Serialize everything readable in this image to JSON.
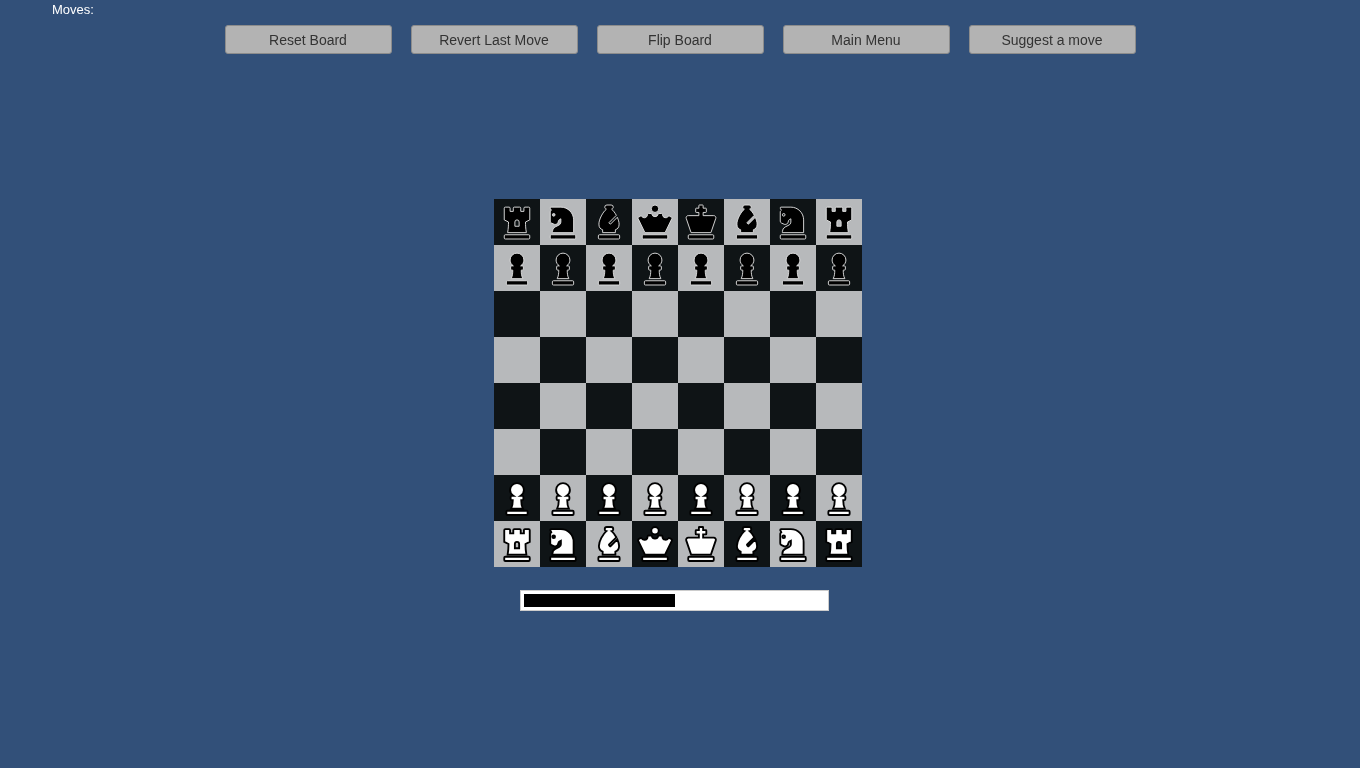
{
  "moves_label": "Moves:",
  "buttons": [
    "Reset Board",
    "Revert Last Move",
    "Flip Board",
    "Main Menu",
    "Suggest a move"
  ],
  "board": [
    [
      {
        "dark": true,
        "kind": "rook",
        "white": false
      },
      {
        "dark": false,
        "kind": "knight",
        "white": false
      },
      {
        "dark": true,
        "kind": "bishop",
        "white": false
      },
      {
        "dark": false,
        "kind": "queen",
        "white": false
      },
      {
        "dark": true,
        "kind": "king",
        "white": false
      },
      {
        "dark": false,
        "kind": "bishop",
        "white": false
      },
      {
        "dark": true,
        "kind": "knight",
        "white": false
      },
      {
        "dark": false,
        "kind": "rook",
        "white": false
      }
    ],
    [
      {
        "dark": false,
        "kind": "pawn",
        "white": false
      },
      {
        "dark": true,
        "kind": "pawn",
        "white": false
      },
      {
        "dark": false,
        "kind": "pawn",
        "white": false
      },
      {
        "dark": true,
        "kind": "pawn",
        "white": false
      },
      {
        "dark": false,
        "kind": "pawn",
        "white": false
      },
      {
        "dark": true,
        "kind": "pawn",
        "white": false
      },
      {
        "dark": false,
        "kind": "pawn",
        "white": false
      },
      {
        "dark": true,
        "kind": "pawn",
        "white": false
      }
    ],
    [
      {
        "dark": true
      },
      {
        "dark": false
      },
      {
        "dark": true
      },
      {
        "dark": false
      },
      {
        "dark": true
      },
      {
        "dark": false
      },
      {
        "dark": true
      },
      {
        "dark": false
      }
    ],
    [
      {
        "dark": false
      },
      {
        "dark": true
      },
      {
        "dark": false
      },
      {
        "dark": true
      },
      {
        "dark": false
      },
      {
        "dark": true
      },
      {
        "dark": false
      },
      {
        "dark": true
      }
    ],
    [
      {
        "dark": true
      },
      {
        "dark": false
      },
      {
        "dark": true
      },
      {
        "dark": false
      },
      {
        "dark": true
      },
      {
        "dark": false
      },
      {
        "dark": true
      },
      {
        "dark": false
      }
    ],
    [
      {
        "dark": false
      },
      {
        "dark": true
      },
      {
        "dark": false
      },
      {
        "dark": true
      },
      {
        "dark": false
      },
      {
        "dark": true
      },
      {
        "dark": false
      },
      {
        "dark": true
      }
    ],
    [
      {
        "dark": true,
        "kind": "pawn",
        "white": true
      },
      {
        "dark": false,
        "kind": "pawn",
        "white": true
      },
      {
        "dark": true,
        "kind": "pawn",
        "white": true
      },
      {
        "dark": false,
        "kind": "pawn",
        "white": true
      },
      {
        "dark": true,
        "kind": "pawn",
        "white": true
      },
      {
        "dark": false,
        "kind": "pawn",
        "white": true
      },
      {
        "dark": true,
        "kind": "pawn",
        "white": true
      },
      {
        "dark": false,
        "kind": "pawn",
        "white": true
      }
    ],
    [
      {
        "dark": false,
        "kind": "rook",
        "white": true
      },
      {
        "dark": true,
        "kind": "knight",
        "white": true
      },
      {
        "dark": false,
        "kind": "bishop",
        "white": true
      },
      {
        "dark": true,
        "kind": "queen",
        "white": true
      },
      {
        "dark": false,
        "kind": "king",
        "white": true
      },
      {
        "dark": true,
        "kind": "bishop",
        "white": true
      },
      {
        "dark": false,
        "kind": "knight",
        "white": true
      },
      {
        "dark": true,
        "kind": "rook",
        "white": true
      }
    ]
  ],
  "evaluation_bar": {
    "level": 0.5
  }
}
